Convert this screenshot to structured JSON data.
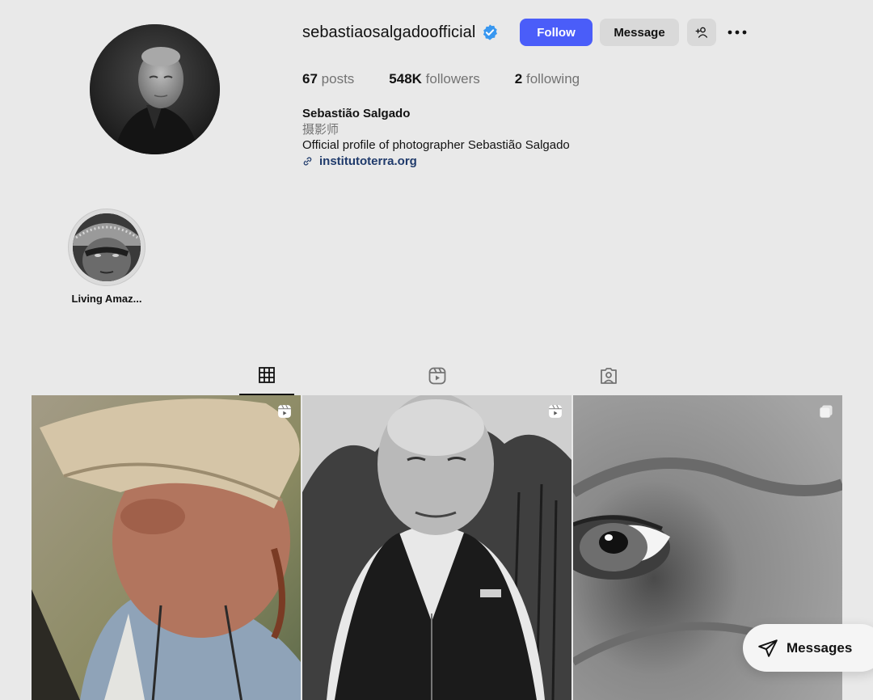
{
  "profile": {
    "username": "sebastiaosalgadoofficial",
    "verified": true,
    "avatar_icon": "profile-photo",
    "buttons": {
      "follow": "Follow",
      "message": "Message",
      "add_user_icon": "add-user-icon",
      "more_icon": "more-icon"
    },
    "stats": {
      "posts_count": "67",
      "posts_label": "posts",
      "followers_count": "548K",
      "followers_label": "followers",
      "following_count": "2",
      "following_label": "following"
    },
    "bio": {
      "name": "Sebastião Salgado",
      "category": "摄影师",
      "text": "Official profile of photographer Sebastião Salgado",
      "link": "institutoterra.org"
    }
  },
  "highlights": [
    {
      "label": "Living Amaz..."
    }
  ],
  "tabs": [
    {
      "name": "posts",
      "icon": "grid-icon",
      "active": true
    },
    {
      "name": "reels",
      "icon": "reels-icon",
      "active": false
    },
    {
      "name": "tagged",
      "icon": "tagged-icon",
      "active": false
    }
  ],
  "posts": [
    {
      "type": "reel",
      "badge_icon": "reel-badge-icon"
    },
    {
      "type": "reel",
      "badge_icon": "reel-badge-icon"
    },
    {
      "type": "carousel",
      "badge_icon": "carousel-badge-icon"
    }
  ],
  "messages_pill": {
    "label": "Messages",
    "icon": "paper-plane-icon"
  },
  "colors": {
    "background": "#e9e9e9",
    "follow_button": "#4a5df9",
    "secondary_button": "#d9d9d9",
    "verified_badge": "#3897f0",
    "link": "#1f3a6b"
  }
}
